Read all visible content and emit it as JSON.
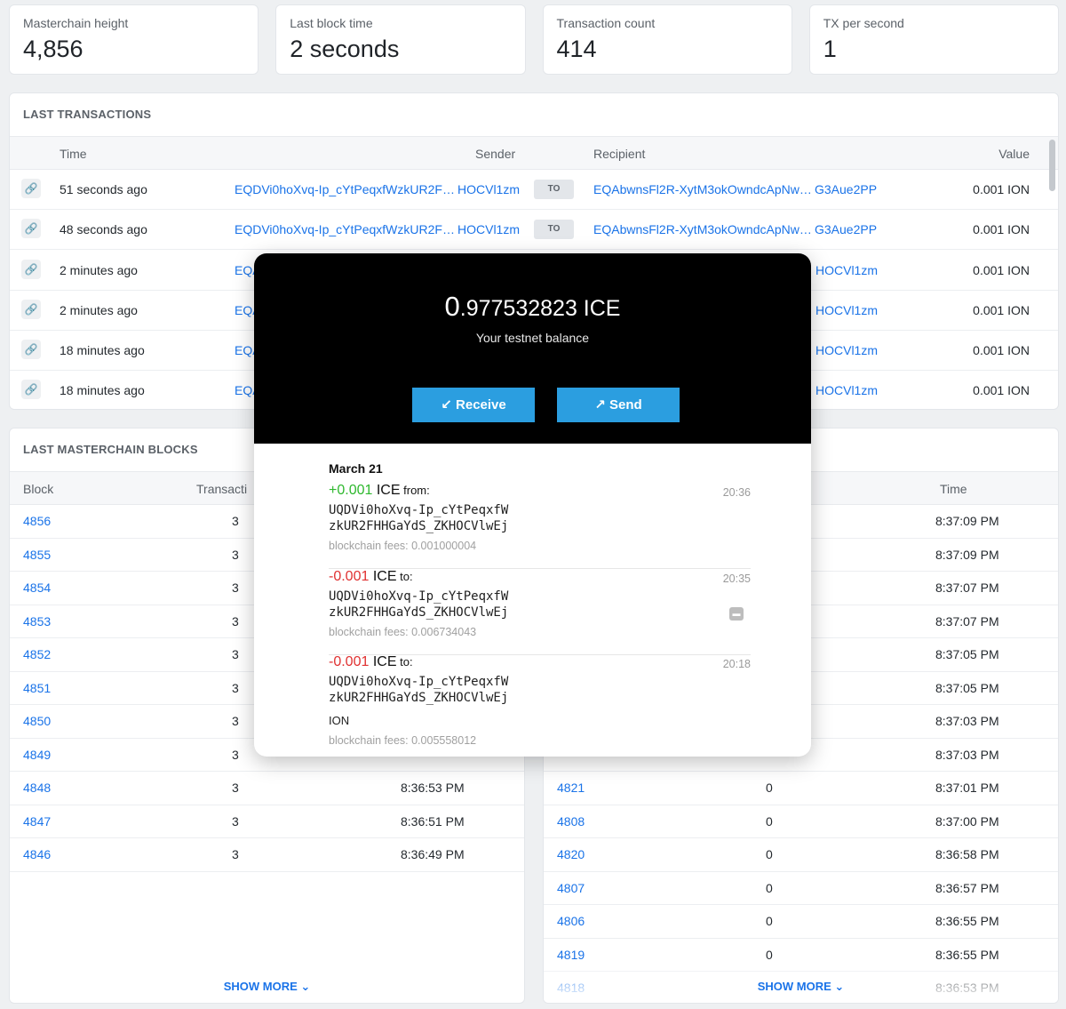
{
  "stats": [
    {
      "label": "Masterchain height",
      "value": "4,856"
    },
    {
      "label": "Last block time",
      "value": "2 seconds"
    },
    {
      "label": "Transaction count",
      "value": "414"
    },
    {
      "label": "TX per second",
      "value": "1"
    }
  ],
  "transactions": {
    "title": "LAST TRANSACTIONS",
    "columns": {
      "time": "Time",
      "sender": "Sender",
      "recipient": "Recipient",
      "value": "Value"
    },
    "to_label": "TO",
    "rows": [
      {
        "time": "51 seconds ago",
        "sender": "EQDVi0hoXvq-Ip_cYtPeqxfWzkUR2F…",
        "sender_tail": "HOCVl1zm",
        "recipient": "EQAbwnsFl2R-XytM3okOwndcApNw…",
        "recipient_tail": "G3Aue2PP",
        "value": "0.001 ION"
      },
      {
        "time": "48 seconds ago",
        "sender": "EQDVi0hoXvq-Ip_cYtPeqxfWzkUR2F…",
        "sender_tail": "HOCVl1zm",
        "recipient": "EQAbwnsFl2R-XytM3okOwndcApNw…",
        "recipient_tail": "G3Aue2PP",
        "value": "0.001 ION"
      },
      {
        "time": "2 minutes ago",
        "sender": "EQA",
        "sender_tail": "",
        "recipient": "",
        "recipient_tail": "HOCVl1zm",
        "value": "0.001 ION"
      },
      {
        "time": "2 minutes ago",
        "sender": "EQA",
        "sender_tail": "",
        "recipient": "",
        "recipient_tail": "HOCVl1zm",
        "value": "0.001 ION"
      },
      {
        "time": "18 minutes ago",
        "sender": "EQA",
        "sender_tail": "",
        "recipient": "",
        "recipient_tail": "HOCVl1zm",
        "value": "0.001 ION"
      },
      {
        "time": "18 minutes ago",
        "sender": "EQA",
        "sender_tail": "",
        "recipient": "",
        "recipient_tail": "HOCVl1zm",
        "value": "0.001 ION"
      }
    ]
  },
  "masterchain": {
    "title": "LAST MASTERCHAIN BLOCKS",
    "columns": {
      "block": "Block",
      "tx": "Transacti",
      "time": ""
    },
    "rows": [
      {
        "block": "4856",
        "tx": "3",
        "time": ""
      },
      {
        "block": "4855",
        "tx": "3",
        "time": ""
      },
      {
        "block": "4854",
        "tx": "3",
        "time": ""
      },
      {
        "block": "4853",
        "tx": "3",
        "time": ""
      },
      {
        "block": "4852",
        "tx": "3",
        "time": ""
      },
      {
        "block": "4851",
        "tx": "3",
        "time": ""
      },
      {
        "block": "4850",
        "tx": "3",
        "time": ""
      },
      {
        "block": "4849",
        "tx": "3",
        "time": ""
      },
      {
        "block": "4848",
        "tx": "3",
        "time": "8:36:53 PM"
      },
      {
        "block": "4847",
        "tx": "3",
        "time": "8:36:51 PM"
      },
      {
        "block": "4846",
        "tx": "3",
        "time": "8:36:49 PM"
      }
    ],
    "show_more": "SHOW MORE"
  },
  "workchain": {
    "columns": {
      "time": "Time"
    },
    "rows": [
      {
        "block": "",
        "tx": "",
        "time": "8:37:09 PM"
      },
      {
        "block": "",
        "tx": "",
        "time": "8:37:09 PM"
      },
      {
        "block": "",
        "tx": "",
        "time": "8:37:07 PM"
      },
      {
        "block": "",
        "tx": "",
        "time": "8:37:07 PM"
      },
      {
        "block": "",
        "tx": "",
        "time": "8:37:05 PM"
      },
      {
        "block": "",
        "tx": "",
        "time": "8:37:05 PM"
      },
      {
        "block": "",
        "tx": "",
        "time": "8:37:03 PM"
      },
      {
        "block": "",
        "tx": "",
        "time": "8:37:03 PM"
      },
      {
        "block": "4821",
        "tx": "0",
        "time": "8:37:01 PM"
      },
      {
        "block": "4808",
        "tx": "0",
        "time": "8:37:00 PM"
      },
      {
        "block": "4820",
        "tx": "0",
        "time": "8:36:58 PM"
      },
      {
        "block": "4807",
        "tx": "0",
        "time": "8:36:57 PM"
      },
      {
        "block": "4806",
        "tx": "0",
        "time": "8:36:55 PM"
      },
      {
        "block": "4819",
        "tx": "0",
        "time": "8:36:55 PM"
      },
      {
        "block": "4818",
        "tx": "",
        "time": "8:36:53 PM"
      }
    ],
    "show_more": "SHOW MORE"
  },
  "wallet": {
    "balance_int": "0",
    "balance_frac": ".977532823 ICE",
    "balance_label": "Your testnet balance",
    "receive_label": "Receive",
    "send_label": "Send",
    "date": "March 21",
    "items": [
      {
        "sign": "+0.001",
        "currency": " ICE",
        "dir": " from:",
        "addr1": "UQDVi0hoXvq-Ip_cYtPeqxfW",
        "addr2": "zkUR2FHHGaYdS_ZKHOCVlwEj",
        "comment": "",
        "fee": "blockchain fees: 0.001000004",
        "time": "20:36"
      },
      {
        "sign": "-0.001",
        "currency": " ICE",
        "dir": " to:",
        "addr1": "UQDVi0hoXvq-Ip_cYtPeqxfW",
        "addr2": "zkUR2FHHGaYdS_ZKHOCVlwEj",
        "comment": "",
        "fee": "blockchain fees: 0.006734043",
        "time": "20:35"
      },
      {
        "sign": "-0.001",
        "currency": " ICE",
        "dir": " to:",
        "addr1": "UQDVi0hoXvq-Ip_cYtPeqxfW",
        "addr2": "zkUR2FHHGaYdS_ZKHOCVlwEj",
        "comment": "ION",
        "fee": "blockchain fees: 0.005558012",
        "time": "20:18"
      }
    ]
  }
}
